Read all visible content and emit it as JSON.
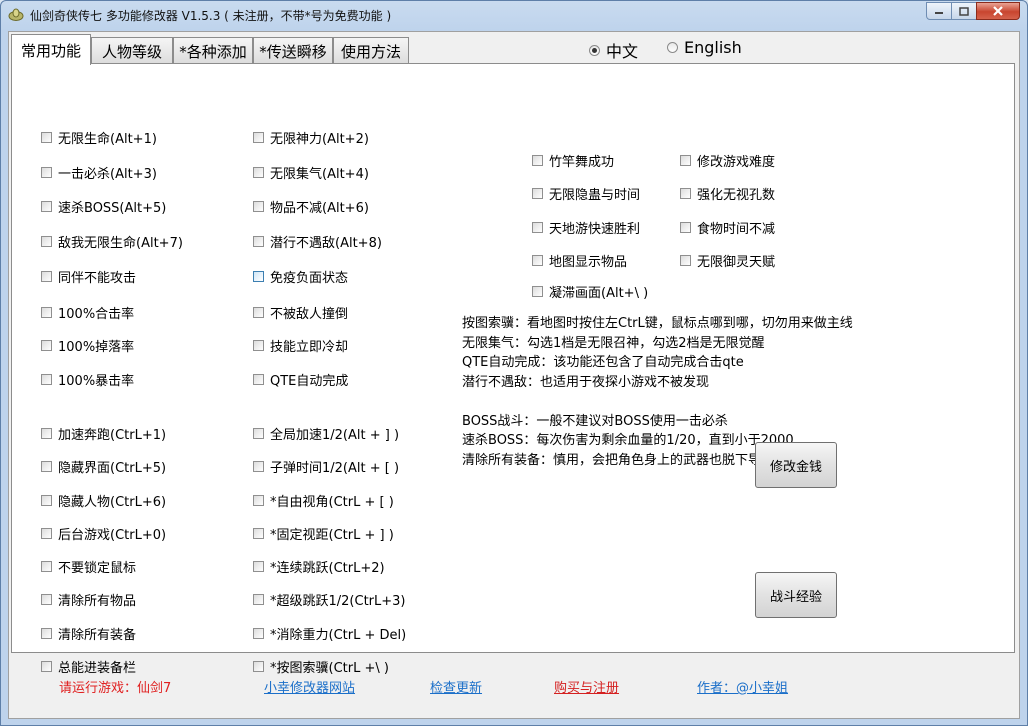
{
  "window": {
    "title": "仙剑奇侠传七 多功能修改器  V1.5.3 ( 未注册，不带*号为免费功能 )",
    "controls": [
      "minimize",
      "maximize",
      "close"
    ]
  },
  "tabs": [
    {
      "label": "常用功能",
      "active": true
    },
    {
      "label": "人物等级",
      "active": false
    },
    {
      "label": "*各种添加",
      "active": false
    },
    {
      "label": "*传送瞬移",
      "active": false
    },
    {
      "label": "使用方法",
      "active": false
    }
  ],
  "language": {
    "options": [
      {
        "label": "中文",
        "selected": true
      },
      {
        "label": "English",
        "selected": false
      }
    ]
  },
  "col1": [
    "无限生命(Alt+1)",
    "一击必杀(Alt+3)",
    "速杀BOSS(Alt+5)",
    "敌我无限生命(Alt+7)",
    "同伴不能攻击",
    "100%合击率",
    "100%掉落率",
    "100%暴击率",
    "加速奔跑(CtrL+1)",
    "隐藏界面(CtrL+5)",
    "隐藏人物(CtrL+6)",
    "后台游戏(CtrL+0)",
    "不要锁定鼠标",
    "清除所有物品",
    "清除所有装备",
    "总能进装备栏"
  ],
  "col2": [
    "无限神力(Alt+2)",
    "无限集气(Alt+4)",
    "物品不减(Alt+6)",
    "潜行不遇敌(Alt+8)",
    "免疫负面状态",
    "不被敌人撞倒",
    "技能立即冷却",
    "QTE自动完成",
    "全局加速1/2(Alt + ] )",
    "子弹时间1/2(Alt + [ )",
    "*自由视角(CtrL + [ )",
    "*固定视距(CtrL + ] )",
    "*连续跳跃(CtrL+2)",
    "*超级跳跃1/2(CtrL+3)",
    "*消除重力(CtrL + Del)",
    "*按图索骥(CtrL +\\ )"
  ],
  "col3": [
    "竹竿舞成功",
    "无限隐蛊与时间",
    "天地游快速胜利",
    "地图显示物品",
    "凝滞画面(Alt+\\ )"
  ],
  "col4": [
    "修改游戏难度",
    "强化无视孔数",
    "食物时间不减",
    "无限御灵天赋"
  ],
  "notes": [
    "按图索骥：看地图时按住左CtrL键，鼠标点哪到哪，切勿用来做主线",
    "无限集气：勾选1档是无限召神，勾选2档是无限觉醒",
    "QTE自动完成：该功能还包含了自动完成合击qte",
    "潜行不遇敌：也适用于夜探小游戏不被发现",
    "",
    "BOSS战斗：一般不建议对BOSS使用一击必杀",
    "速杀BOSS：每次伤害为剩余血量的1/20，直到小于2000",
    "清除所有装备：慎用，会把角色身上的武器也脱下导致行走困难"
  ],
  "buttons": {
    "money": "修改金钱",
    "exp": "战斗经验"
  },
  "footer": {
    "status": "请运行游戏：仙剑7",
    "site": "小幸修改器网站",
    "update": "检查更新",
    "buy": "购买与注册",
    "author": "作者：@小幸姐"
  },
  "colors": {
    "status_red": "#e02020",
    "buy_red": "#d42020",
    "link_blue": "#1b6fc9",
    "titlebar": "#bed3ec"
  }
}
